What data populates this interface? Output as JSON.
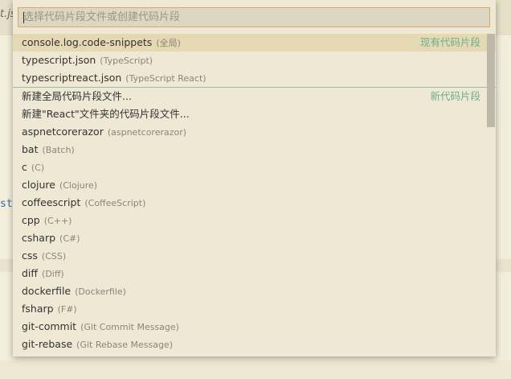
{
  "background": {
    "tab_fragment": "t.js",
    "code_fragment": "st"
  },
  "quickpick": {
    "placeholder": "选择代码片段文件或创建代码片段",
    "items": [
      {
        "label": "console.log.code-snippets",
        "desc": "(全局)",
        "group": "现有代码片段",
        "selected": true
      },
      {
        "label": "typescript.json",
        "desc": "(TypeScript)"
      },
      {
        "label": "typescriptreact.json",
        "desc": "(TypeScript React)"
      },
      {
        "label": "新建全局代码片段文件...",
        "desc": "",
        "group": "新代码片段",
        "separator": true
      },
      {
        "label": "新建\"React\"文件夹的代码片段文件...",
        "desc": ""
      },
      {
        "label": "aspnetcorerazor",
        "desc": "(aspnetcorerazor)"
      },
      {
        "label": "bat",
        "desc": "(Batch)"
      },
      {
        "label": "c",
        "desc": "(C)"
      },
      {
        "label": "clojure",
        "desc": "(Clojure)"
      },
      {
        "label": "coffeescript",
        "desc": "(CoffeeScript)"
      },
      {
        "label": "cpp",
        "desc": "(C++)"
      },
      {
        "label": "csharp",
        "desc": "(C#)"
      },
      {
        "label": "css",
        "desc": "(CSS)"
      },
      {
        "label": "diff",
        "desc": "(Diff)"
      },
      {
        "label": "dockerfile",
        "desc": "(Dockerfile)"
      },
      {
        "label": "fsharp",
        "desc": "(F#)"
      },
      {
        "label": "git-commit",
        "desc": "(Git Commit Message)"
      },
      {
        "label": "git-rebase",
        "desc": "(Git Rebase Message)"
      }
    ]
  },
  "colors": {
    "accent_border": "#d9a86e",
    "group_label": "#6fae8c",
    "selected_bg": "#e4d9b2"
  }
}
